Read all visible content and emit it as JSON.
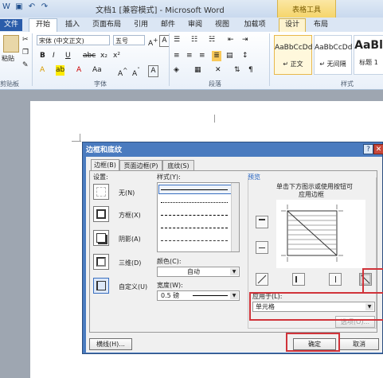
{
  "window": {
    "title": "文档1 [兼容模式] - Microsoft Word",
    "context_tab": "表格工具"
  },
  "tabs": [
    {
      "label": "文件"
    },
    {
      "label": "开始"
    },
    {
      "label": "插入"
    },
    {
      "label": "页面布局"
    },
    {
      "label": "引用"
    },
    {
      "label": "邮件"
    },
    {
      "label": "审阅"
    },
    {
      "label": "视图"
    },
    {
      "label": "加载项"
    },
    {
      "label": "设计"
    },
    {
      "label": "布局"
    }
  ],
  "ribbon": {
    "paste_label": "粘贴",
    "clipboard_label": "剪贴板",
    "font_name": "宋体 (中文正文)",
    "font_size": "五号",
    "font_group_label": "字体",
    "paragraph_group_label": "段落",
    "styles_group_label": "样式",
    "styles": [
      {
        "preview": "AaBbCcDd",
        "name": "↵ 正文"
      },
      {
        "preview": "AaBbCcDd",
        "name": "↵ 无间隔"
      },
      {
        "preview": "AaBl",
        "name": "标题 1"
      }
    ]
  },
  "dialog": {
    "title": "边框和底纹",
    "tabs": [
      "边框(B)",
      "页面边框(P)",
      "底纹(S)"
    ],
    "setting_label": "设置:",
    "settings": [
      "无(N)",
      "方框(X)",
      "阴影(A)",
      "三维(D)",
      "自定义(U)"
    ],
    "style_label": "样式(Y):",
    "color_label": "颜色(C):",
    "color_value": "自动",
    "width_label": "宽度(W):",
    "width_value": "0.5 磅",
    "preview_label": "预览",
    "preview_hint_line1": "单击下方图示或使用按钮可",
    "preview_hint_line2": "应用边框",
    "apply_label": "应用于(L):",
    "apply_value": "单元格",
    "options_button": "选项(O)...",
    "hline_button": "横线(H)...",
    "ok_button": "确定",
    "cancel_button": "取消"
  },
  "colors": {
    "highlight": "#d0333a",
    "dialog_frame": "#4a7bbf",
    "file_tab": "#2a5caa"
  }
}
